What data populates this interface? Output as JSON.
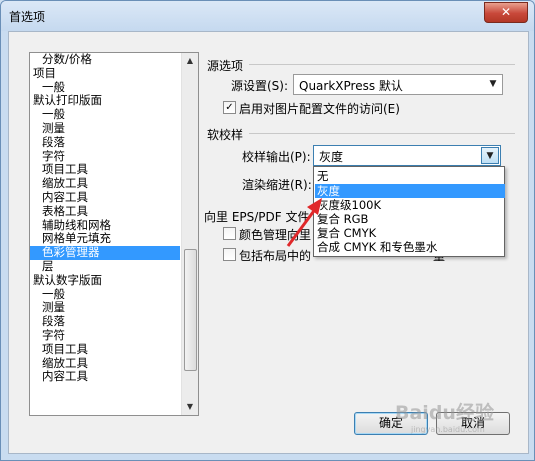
{
  "window": {
    "title": "首选项",
    "close_glyph": "✕"
  },
  "tree": {
    "items": [
      {
        "label": "分数/价格",
        "level": 2,
        "selected": false
      },
      {
        "label": "项目",
        "level": 1,
        "selected": false
      },
      {
        "label": "一般",
        "level": 2,
        "selected": false
      },
      {
        "label": "默认打印版面",
        "level": 1,
        "selected": false
      },
      {
        "label": "一般",
        "level": 2,
        "selected": false
      },
      {
        "label": "测量",
        "level": 2,
        "selected": false
      },
      {
        "label": "段落",
        "level": 2,
        "selected": false
      },
      {
        "label": "字符",
        "level": 2,
        "selected": false
      },
      {
        "label": "项目工具",
        "level": 2,
        "selected": false
      },
      {
        "label": "缩放工具",
        "level": 2,
        "selected": false
      },
      {
        "label": "内容工具",
        "level": 2,
        "selected": false
      },
      {
        "label": "表格工具",
        "level": 2,
        "selected": false
      },
      {
        "label": "辅助线和网格",
        "level": 2,
        "selected": false
      },
      {
        "label": "网格单元填充",
        "level": 2,
        "selected": false
      },
      {
        "label": "色彩管理器",
        "level": 2,
        "selected": true
      },
      {
        "label": "层",
        "level": 2,
        "selected": false
      },
      {
        "label": "默认数字版面",
        "level": 1,
        "selected": false
      },
      {
        "label": "一般",
        "level": 2,
        "selected": false
      },
      {
        "label": "测量",
        "level": 2,
        "selected": false
      },
      {
        "label": "段落",
        "level": 2,
        "selected": false
      },
      {
        "label": "字符",
        "level": 2,
        "selected": false
      },
      {
        "label": "项目工具",
        "level": 2,
        "selected": false
      },
      {
        "label": "缩放工具",
        "level": 2,
        "selected": false
      },
      {
        "label": "内容工具",
        "level": 2,
        "selected": false
      }
    ],
    "scroll_up": "▲",
    "scroll_down": "▼"
  },
  "source_options": {
    "heading": "源选项",
    "setting_label": "源设置(S):",
    "setting_value": "QuarkXPress 默认",
    "enable_profiles_label": "启用对图片配置文件的访问(E)",
    "enable_profiles_checked": true
  },
  "soft_proof": {
    "heading": "软校样",
    "proof_output_label": "校样输出(P):",
    "proof_output_value": "灰度",
    "rendering_label": "渲染缩进(R):",
    "options": [
      "无",
      "灰度",
      "灰度级100K",
      "复合 RGB",
      "复合 CMYK",
      "合成 CMYK 和专色墨水"
    ],
    "highlighted_index": 1
  },
  "eps_pdf": {
    "heading": "向里 EPS/PDF 文件",
    "color_mgmt_label": "颜色管理向里",
    "include_layout_label": "包括布局中的",
    "include_layout_suffix": "量",
    "color_mgmt_checked": false,
    "include_layout_checked": false
  },
  "buttons": {
    "ok": "确定",
    "cancel": "取消"
  },
  "icons": {
    "checkbox_check": "✓",
    "combo_arrow": "▼"
  },
  "colors": {
    "selection": "#3399ff",
    "annotation_arrow": "#e0282a"
  },
  "watermark": {
    "text": "Baidu经验",
    "subtext": "jingyan.baidu.com"
  }
}
